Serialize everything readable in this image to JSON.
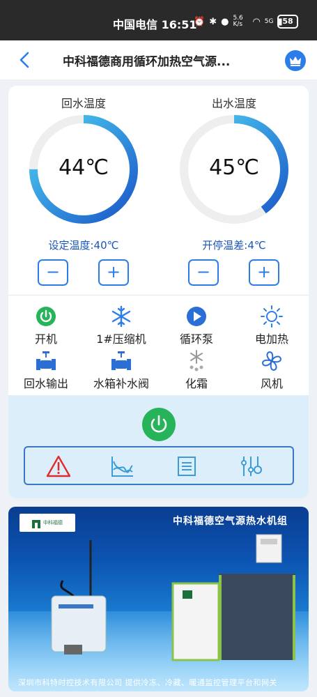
{
  "status_bar": {
    "carrier_time": "中国电信 16:51",
    "net_speed": "5.6 K/s",
    "network": "5G",
    "battery": "58"
  },
  "header": {
    "title": "中科福德商用循环加热空气源..."
  },
  "gauges": [
    {
      "label": "回水温度",
      "value": "44℃",
      "setting": "设定温度:40℃",
      "level": 0.75
    },
    {
      "label": "出水温度",
      "value": "45℃",
      "setting": "开停温差:4℃",
      "level": 0.4
    }
  ],
  "stepper": {
    "minus": "−",
    "plus": "+"
  },
  "functions": [
    {
      "label": "开机",
      "icon": "power-on-icon"
    },
    {
      "label": "1#压缩机",
      "icon": "snowflake-icon"
    },
    {
      "label": "循环泵",
      "icon": "pump-play-icon"
    },
    {
      "label": "电加热",
      "icon": "sun-heater-icon"
    },
    {
      "label": "回水输出",
      "icon": "valve-icon"
    },
    {
      "label": "水箱补水阀",
      "icon": "valve-icon"
    },
    {
      "label": "化霜",
      "icon": "defrost-icon"
    },
    {
      "label": "风机",
      "icon": "fan-icon"
    }
  ],
  "toolbar": [
    "warning-icon",
    "chart-icon",
    "list-icon",
    "settings-sliders-icon"
  ],
  "banner": {
    "title": "中科福德空气源热水机组",
    "logo_text": "中科福德",
    "footer": "深圳市科特时控技术有限公司   提供冷冻、冷藏、暖通监控管理平台和网关"
  },
  "colors": {
    "accent": "#2b7de9",
    "gauge_start": "#1a56c8",
    "gauge_end": "#4fd3f3",
    "power_green": "#27b35a",
    "panel_bg": "#dceefa"
  }
}
